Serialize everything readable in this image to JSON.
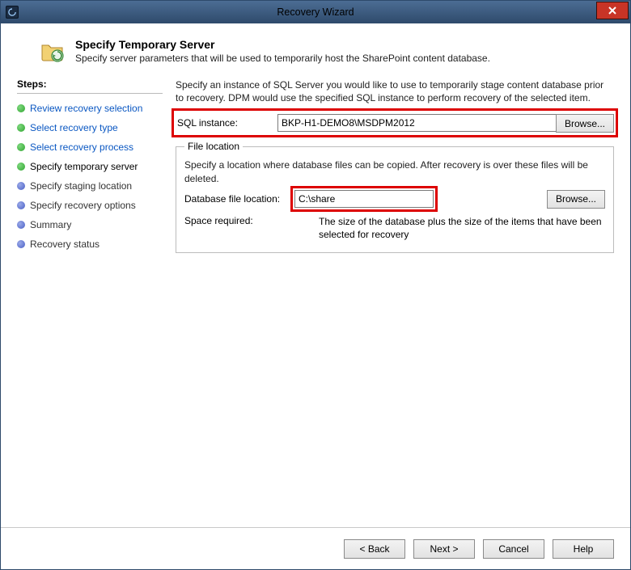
{
  "window": {
    "title": "Recovery Wizard"
  },
  "header": {
    "title": "Specify Temporary Server",
    "subtitle": "Specify server parameters that will be used to temporarily host the SharePoint content database."
  },
  "sidebar": {
    "label": "Steps:",
    "items": [
      {
        "label": "Review recovery selection",
        "state": "done",
        "link": true
      },
      {
        "label": "Select recovery type",
        "state": "done",
        "link": true
      },
      {
        "label": "Select recovery process",
        "state": "done",
        "link": true
      },
      {
        "label": "Specify temporary server",
        "state": "current",
        "link": false
      },
      {
        "label": "Specify staging location",
        "state": "pending",
        "link": false
      },
      {
        "label": "Specify recovery options",
        "state": "pending",
        "link": false
      },
      {
        "label": "Summary",
        "state": "pending",
        "link": false
      },
      {
        "label": "Recovery status",
        "state": "pending",
        "link": false
      }
    ]
  },
  "main": {
    "instruction": "Specify an instance of SQL Server you would like to use to temporarily stage content database prior to recovery. DPM would use the specified SQL instance to perform recovery of the selected item.",
    "sql_instance_label": "SQL instance:",
    "sql_instance_value": "BKP-H1-DEMO8\\MSDPM2012",
    "browse1": "Browse...",
    "file_location_legend": "File location",
    "file_location_instruction": "Specify a location where database files can be copied. After recovery is over these files will be deleted.",
    "db_file_location_label": "Database file location:",
    "db_file_location_value": "C:\\share",
    "browse2": "Browse...",
    "space_required_label": "Space required:",
    "space_required_value": "The size of the database plus the size of the items that have been selected for recovery"
  },
  "footer": {
    "back": "< Back",
    "next": "Next >",
    "cancel": "Cancel",
    "help": "Help"
  }
}
